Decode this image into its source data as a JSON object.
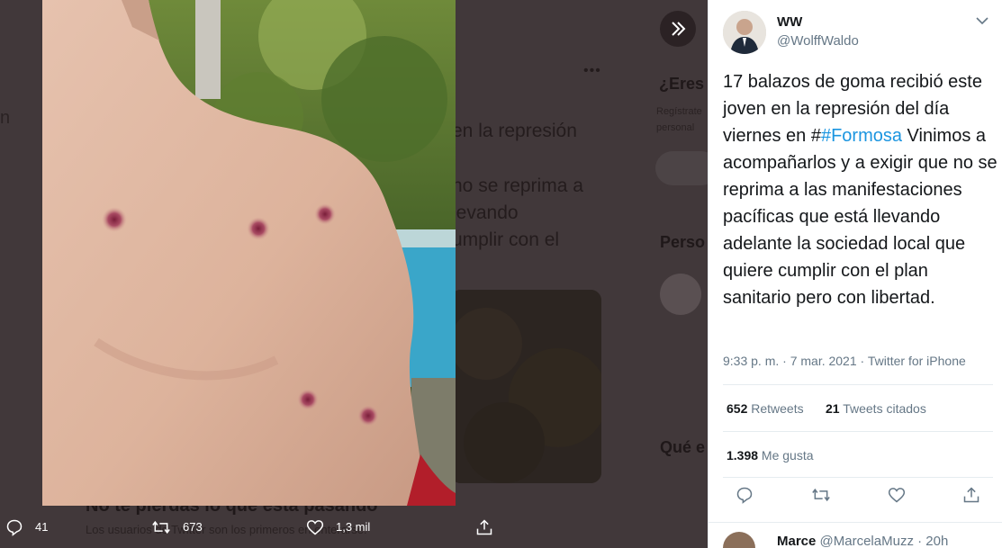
{
  "background": {
    "text_lines": [
      "en la represión",
      "no se reprima a",
      "levando",
      "umplir con el"
    ],
    "sidebar_prompt": "¿Eres",
    "sidebar_small_1": "Regístrate",
    "sidebar_small_2": "personal",
    "people_heading": "Perso",
    "trends_heading": "Qué e",
    "banner_title": "No te pierdas lo que está pasando",
    "banner_sub": "Los usuarios de Twitter son los primeros en enterarse.",
    "left_edge": "n"
  },
  "media_actions": {
    "replies": "41",
    "retweets": "673",
    "likes": "1,3 mil"
  },
  "tweet": {
    "name": "WW",
    "handle": "@WolffWaldo",
    "text_before": "17 balazos de goma recibió este joven en la represión del día viernes en #",
    "hashtag": "#Formosa",
    "text_after": " Vinimos a acompañarlos y a exigir que no se reprima a las manifestaciones pacíficas que está llevando adelante la sociedad local que quiere cumplir con el plan sanitario pero con libertad.",
    "meta": "9:33 p. m. · 7 mar. 2021 · Twitter for iPhone",
    "retweets_count": "652",
    "retweets_label": " Retweets",
    "quotes_count": "21",
    "quotes_label": " Tweets citados",
    "likes_count": "1.398",
    "likes_label": " Me gusta"
  },
  "reply": {
    "name": "Marce",
    "handle": "@MarcelaMuzz · 20h"
  },
  "colors": {
    "accent": "#1b95e0",
    "overlay": "#41383a"
  }
}
